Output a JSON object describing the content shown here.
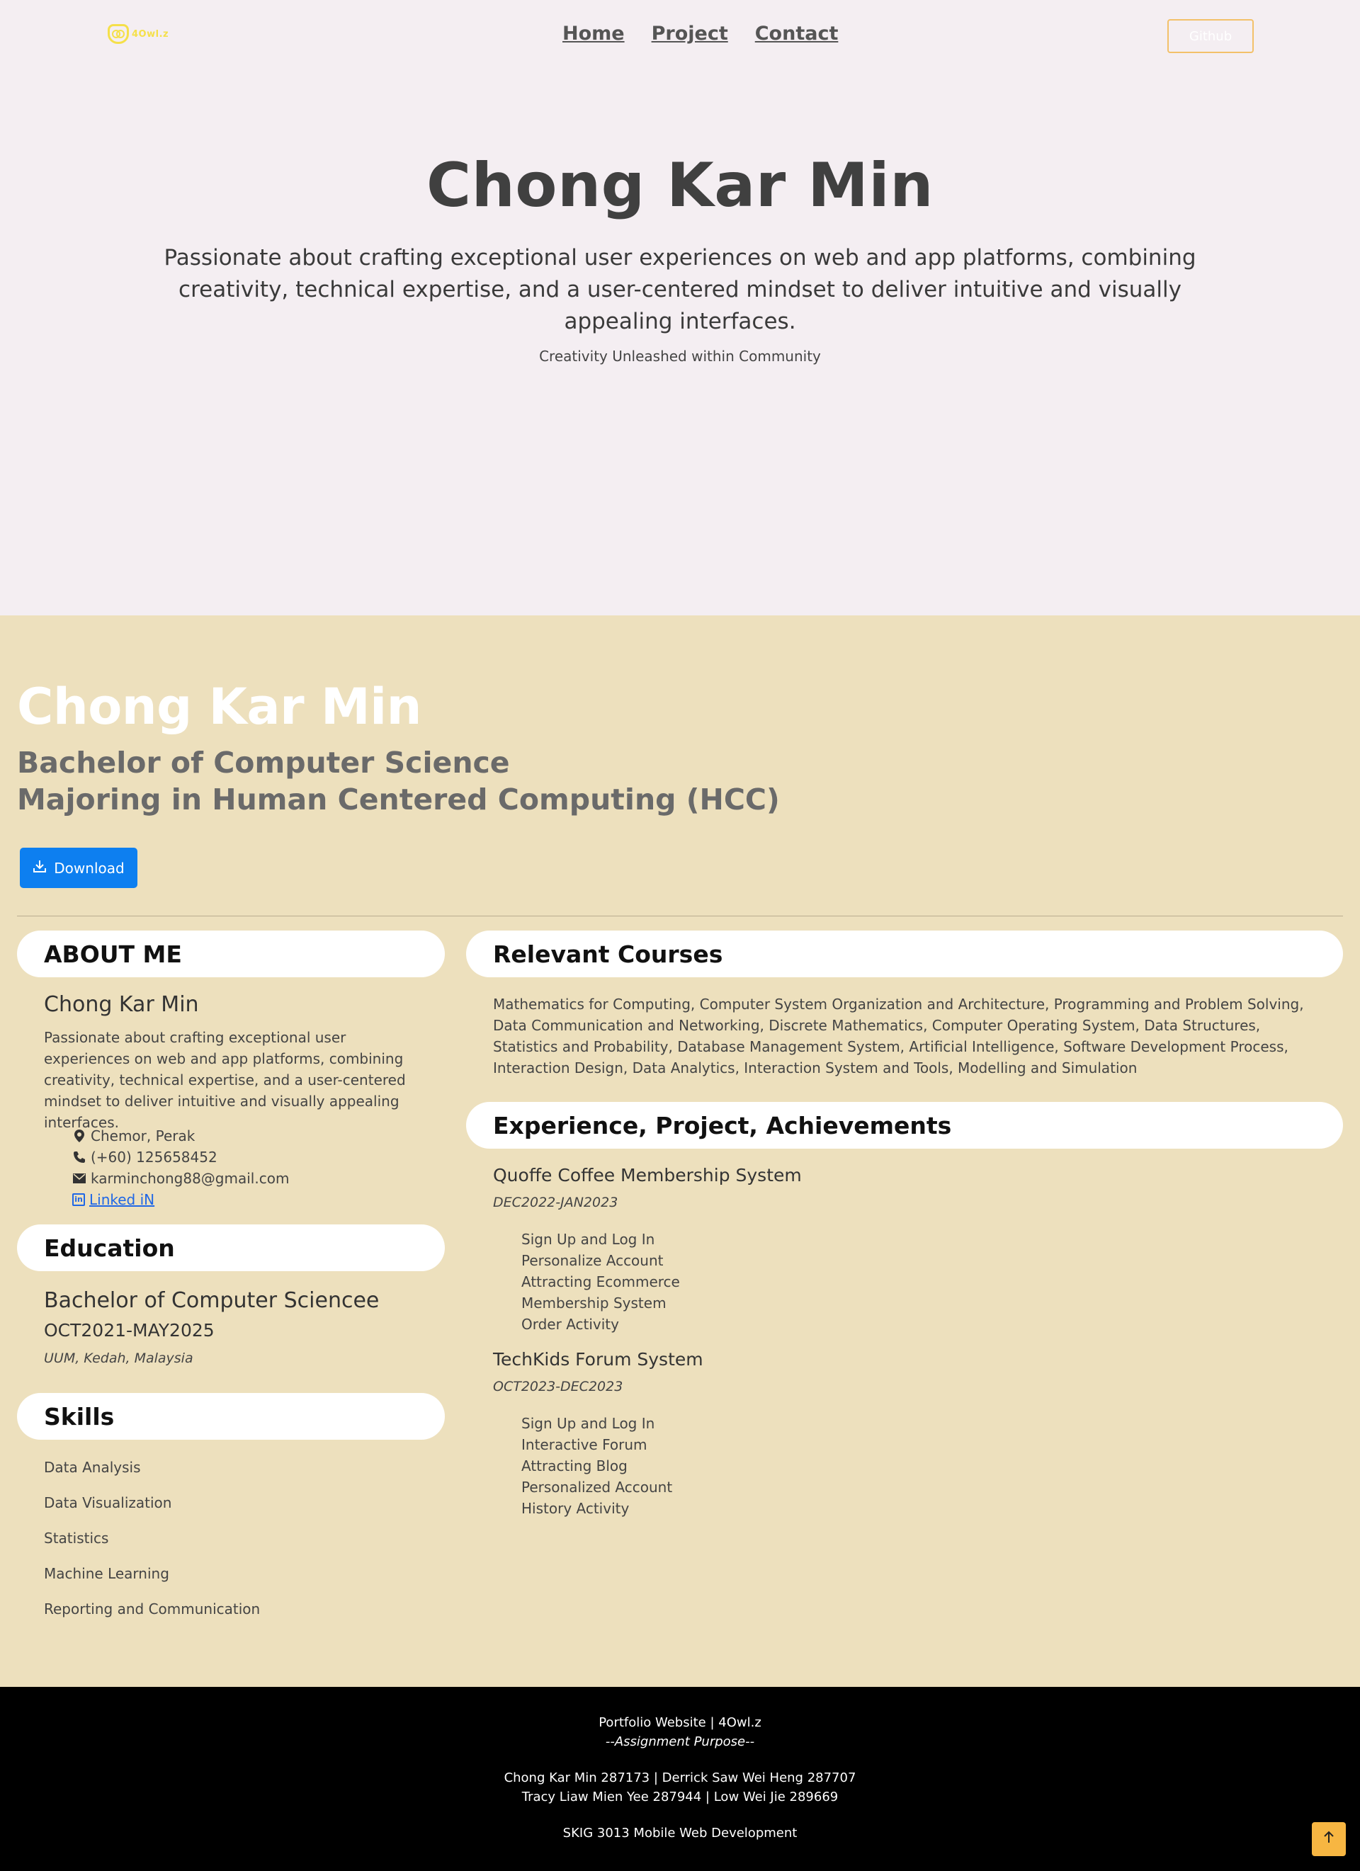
{
  "nav": {
    "logo_text": "4Owl.z",
    "links": [
      "Home",
      "Project",
      "Contact"
    ],
    "github_label": "Github"
  },
  "hero": {
    "title": "Chong Kar Min",
    "description": "Passionate about crafting exceptional user experiences on web and app platforms, combining creativity, technical expertise, and a user-centered mindset to deliver intuitive and visually appealing interfaces.",
    "tagline": "Creativity Unleashed within Community"
  },
  "profile": {
    "name": "Chong Kar Min",
    "degree_line1": "Bachelor of Computer Science",
    "degree_line2": "Majoring in Human Centered Computing (HCC)",
    "download_label": "Download"
  },
  "about": {
    "heading": "ABOUT ME",
    "name": "Chong Kar Min",
    "description": "Passionate about crafting exceptional user experiences on web and app platforms, combining creativity, technical expertise, and a user-centered mindset to deliver intuitive and visually appealing interfaces.",
    "location": "Chemor, Perak",
    "phone": "(+60) 125658452",
    "email": "karminchong88@gmail.com",
    "linkedin": " Linked iN"
  },
  "education": {
    "heading": "Education",
    "degree": "Bachelor of Computer Sciencee",
    "dates": "OCT2021-MAY2025",
    "place": "UUM, Kedah, Malaysia"
  },
  "skills": {
    "heading": "Skills",
    "items": [
      "Data Analysis",
      "Data Visualization",
      "Statistics",
      "Machine Learning",
      "Reporting and Communication"
    ]
  },
  "courses": {
    "heading": "Relevant Courses",
    "text": "Mathematics for Computing, Computer System Organization and Architecture, Programming and Problem Solving, Data Communication and Networking, Discrete Mathematics, Computer Operating System, Data Structures, Statistics and Probability, Database Management System, Artificial Intelligence, Software Development Process, Interaction Design, Data Analytics, Interaction System and Tools, Modelling and Simulation"
  },
  "experience": {
    "heading": "Experience, Project, Achievements",
    "projects": [
      {
        "title": "Quoffe Coffee Membership System",
        "date": "DEC2022-JAN2023",
        "items": [
          "Sign Up and Log In",
          "Personalize Account",
          "Attracting Ecommerce",
          "Membership System",
          "Order Activity"
        ]
      },
      {
        "title": "TechKids Forum System",
        "date": "OCT2023-DEC2023",
        "items": [
          "Sign Up and Log In",
          "Interactive Forum",
          "Attracting Blog",
          "Personalized Account",
          "History Activity"
        ]
      }
    ]
  },
  "footer": {
    "line1": "Portfolio Website | 4Owl.z",
    "line2": "--Assignment Purpose--",
    "line3": "Chong Kar Min 287173 | Derrick Saw Wei Heng 287707",
    "line4": "Tracy Liaw Mien Yee 287944 | Low Wei Jie 289669",
    "line5": "SKIG 3013 Mobile Web Development",
    "top_button_icon": "arrow-up-icon"
  }
}
